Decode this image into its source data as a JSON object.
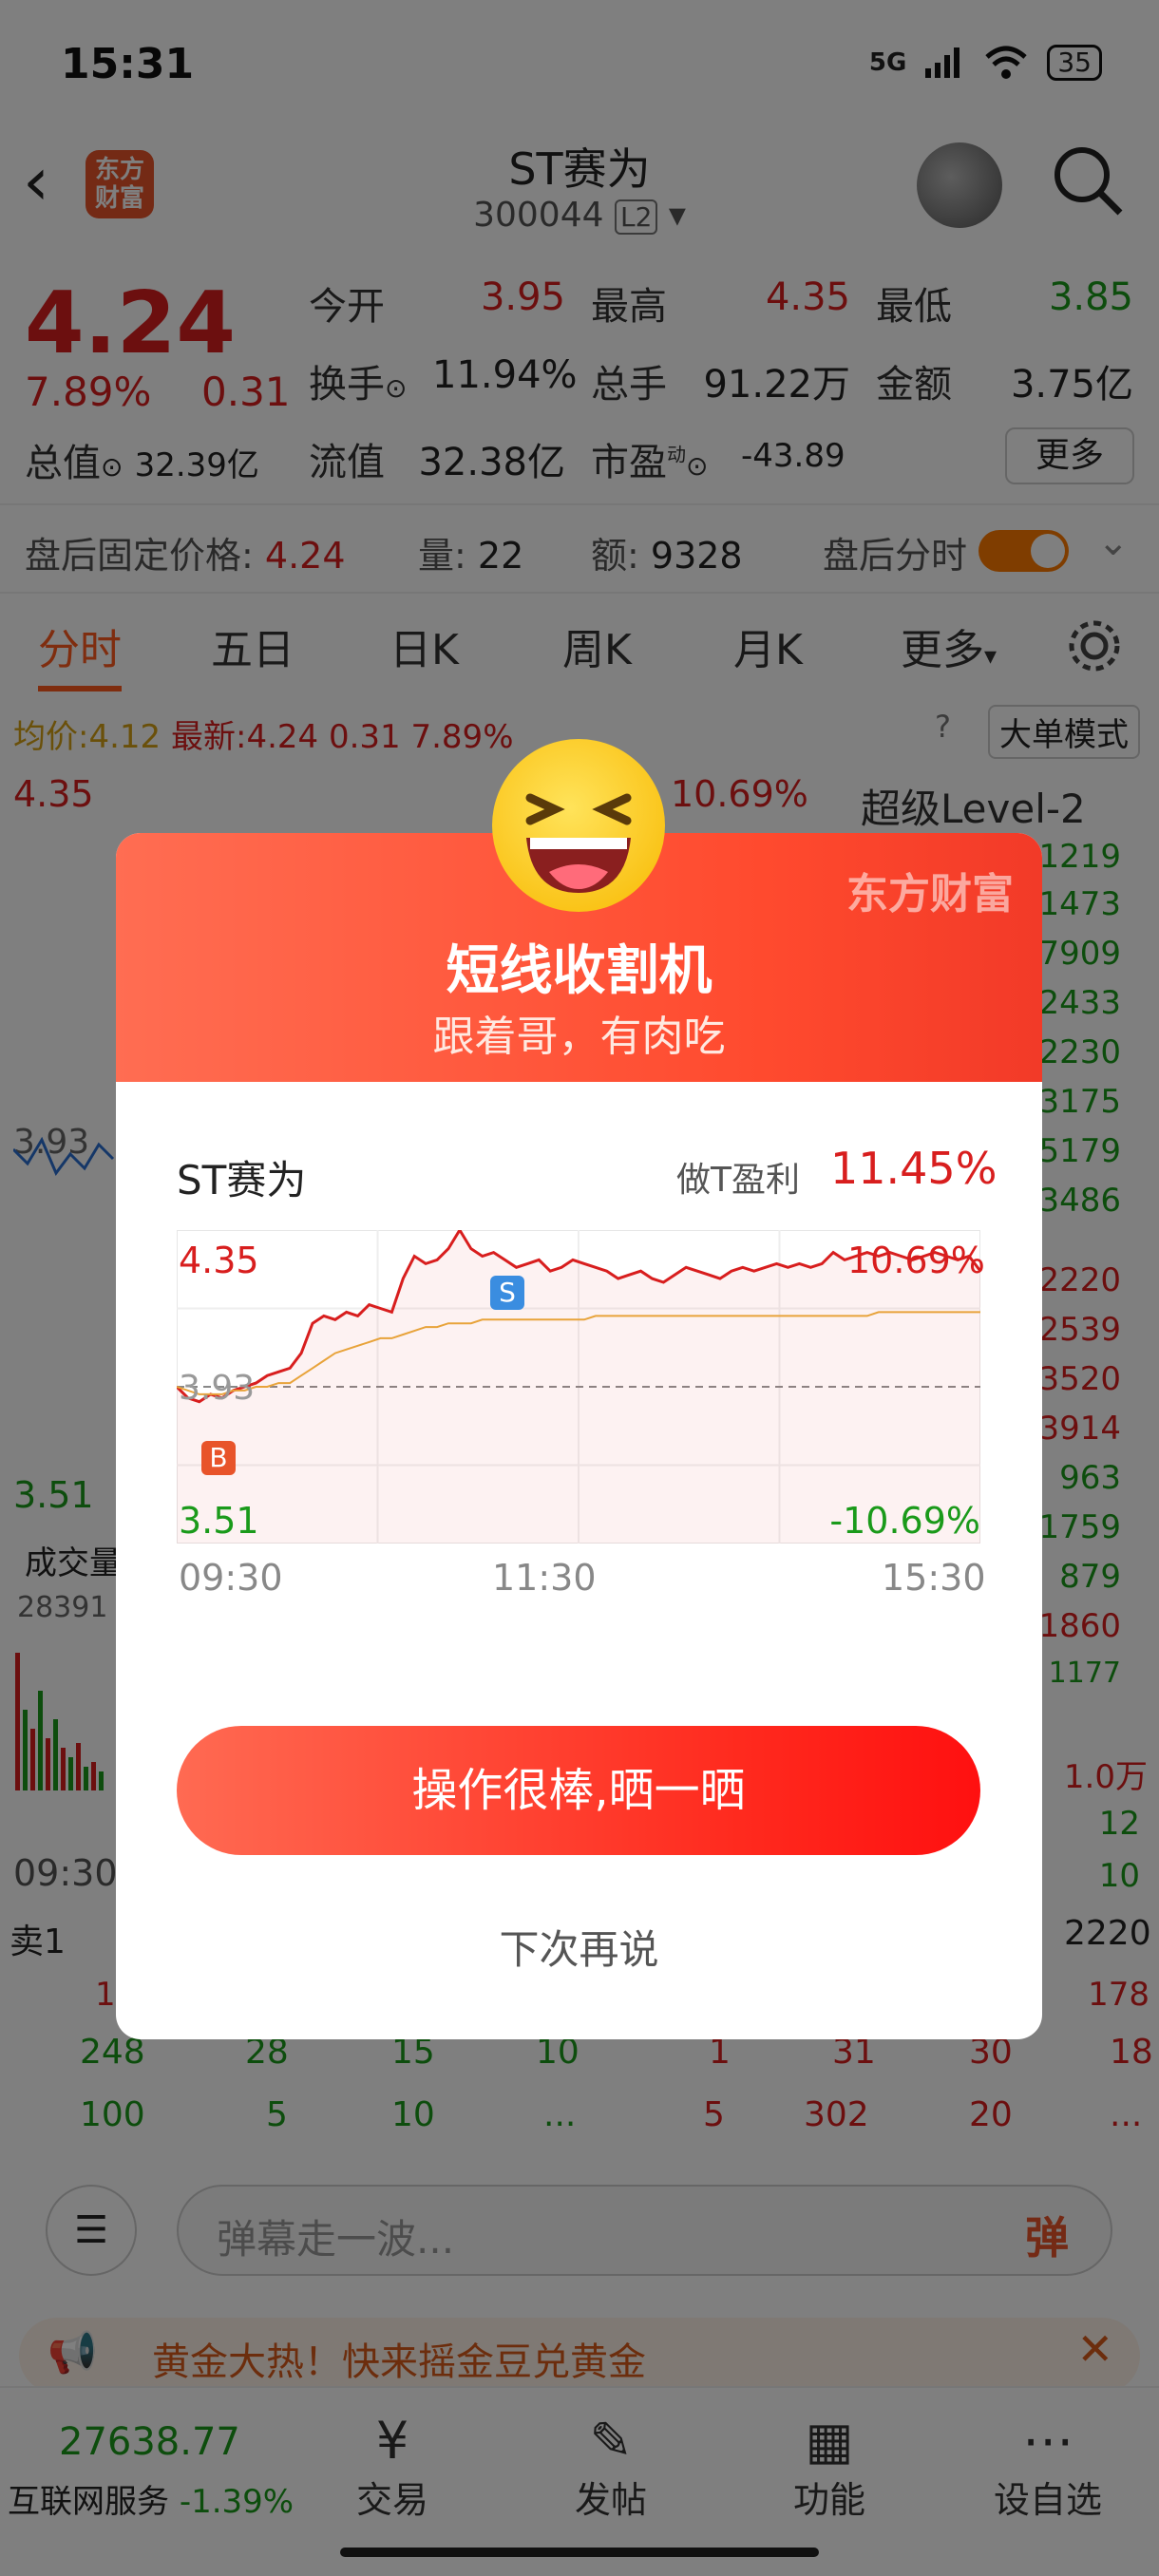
{
  "status_bar": {
    "time": "15:31",
    "network": "5G",
    "battery": "35"
  },
  "header": {
    "title": "ST赛为",
    "code": "300044",
    "level": "L2",
    "logo_line1": "东方",
    "logo_line2": "财富"
  },
  "quote": {
    "price": "4.24",
    "change_pct": "7.89%",
    "change": "0.31",
    "open_label": "今开",
    "open": "3.95",
    "high_label": "最高",
    "high": "4.35",
    "low_label": "最低",
    "low": "3.85",
    "turnover_label": "换手",
    "turnover": "11.94%",
    "volume_label": "总手",
    "volume": "91.22万",
    "amount_label": "金额",
    "amount": "3.75亿",
    "mktcap_label": "总值",
    "mktcap": "32.39亿",
    "float_label": "流值",
    "float": "32.38亿",
    "pe_label": "市盈",
    "pe_sup": "动",
    "pe": "-43.89",
    "more_label": "更多"
  },
  "after_hours": {
    "price_label": "盘后固定价格:",
    "price": "4.24",
    "vol_label": "量:",
    "vol": "22",
    "amt_label": "额:",
    "amt": "9328",
    "split_label": "盘后分时"
  },
  "tabs": [
    "分时",
    "五日",
    "日K",
    "周K",
    "月K",
    "更多"
  ],
  "chart_info": {
    "avg_label": "均价:",
    "avg": "4.12",
    "last_label": "最新:",
    "last": "4.24",
    "chg": "0.31",
    "pct": "7.89%",
    "mode_btn": "大单模式"
  },
  "bg_chart": {
    "top": "4.35",
    "top_pct": "10.69%",
    "mid": "3.93",
    "bottom": "3.51",
    "vol_label": "成交量",
    "vol_max": "28391",
    "time_start": "09:30",
    "level2": "超级Level-2",
    "right_col": [
      "1219",
      "1473",
      "7909",
      "2433",
      "2230",
      "3175",
      "5179",
      "3486",
      "2220",
      "2539",
      "3520",
      "3914",
      "963",
      "1759",
      "879",
      "1860",
      "1177"
    ],
    "sell_label": "卖1",
    "sell_val": "2220",
    "row_a": [
      "248",
      "28",
      "15",
      "10",
      "1",
      "31",
      "30",
      "18"
    ],
    "row_b": [
      "100",
      "5",
      "10",
      "...",
      "5",
      "302",
      "20",
      "..."
    ],
    "misc": [
      "1",
      "178",
      "1.0万",
      "12",
      "10"
    ]
  },
  "comment": {
    "placeholder": "弹幕走一波...",
    "danmu": "弹"
  },
  "banner": {
    "text": "黄金大热！快来摇金豆兑黄金"
  },
  "bottom_bar": {
    "index_value": "27638.77",
    "index_name": "互联网服务",
    "index_pct": "-1.39%",
    "items": [
      "交易",
      "发帖",
      "功能",
      "设自选"
    ]
  },
  "modal": {
    "brand": "东方财富",
    "title": "短线收割机",
    "subtitle": "跟着哥，有肉吃",
    "stock": "ST赛为",
    "profit_label": "做T盈利",
    "profit": "11.45%",
    "cta": "操作很棒,晒一晒",
    "later": "下次再说",
    "buy_mark": "B",
    "sell_mark": "S"
  },
  "chart_data": {
    "type": "line",
    "y_top": "4.35",
    "y_mid": "3.93",
    "y_bottom": "3.51",
    "pct_top": "10.69%",
    "pct_bottom": "-10.69%",
    "x_ticks": [
      "09:30",
      "11:30",
      "15:30"
    ],
    "ylim": [
      3.51,
      4.35
    ],
    "prev_close": 3.93,
    "series": [
      {
        "color": "#d81e1e",
        "values": [
          3.93,
          3.9,
          3.89,
          3.91,
          3.9,
          3.92,
          3.93,
          3.94,
          3.96,
          3.97,
          3.98,
          4.02,
          4.1,
          4.12,
          4.11,
          4.13,
          4.12,
          4.15,
          4.14,
          4.13,
          4.22,
          4.28,
          4.26,
          4.27,
          4.3,
          4.35,
          4.3,
          4.28,
          4.29,
          4.27,
          4.25,
          4.26,
          4.27,
          4.24,
          4.25,
          4.27,
          4.26,
          4.25,
          4.24,
          4.22,
          4.23,
          4.24,
          4.22,
          4.21,
          4.23,
          4.25,
          4.24,
          4.23,
          4.22,
          4.24,
          4.25,
          4.24,
          4.25,
          4.26,
          4.25,
          4.26,
          4.25,
          4.26,
          4.29,
          4.27,
          4.28,
          4.29,
          4.28,
          4.29,
          4.28,
          4.27,
          4.28,
          4.29,
          4.28,
          4.27,
          4.28,
          4.24
        ]
      },
      {
        "color": "#e8a33a",
        "values": [
          3.93,
          3.92,
          3.91,
          3.91,
          3.91,
          3.92,
          3.92,
          3.93,
          3.93,
          3.94,
          3.94,
          3.96,
          3.98,
          4.0,
          4.02,
          4.03,
          4.04,
          4.05,
          4.06,
          4.06,
          4.07,
          4.08,
          4.09,
          4.09,
          4.1,
          4.1,
          4.1,
          4.11,
          4.11,
          4.11,
          4.11,
          4.11,
          4.11,
          4.11,
          4.11,
          4.11,
          4.11,
          4.12,
          4.12,
          4.12,
          4.12,
          4.12,
          4.12,
          4.12,
          4.12,
          4.12,
          4.12,
          4.12,
          4.12,
          4.12,
          4.12,
          4.12,
          4.12,
          4.12,
          4.12,
          4.12,
          4.12,
          4.12,
          4.12,
          4.12,
          4.12,
          4.12,
          4.13,
          4.13,
          4.13,
          4.13,
          4.13,
          4.13,
          4.13,
          4.13,
          4.13,
          4.13
        ]
      }
    ]
  }
}
